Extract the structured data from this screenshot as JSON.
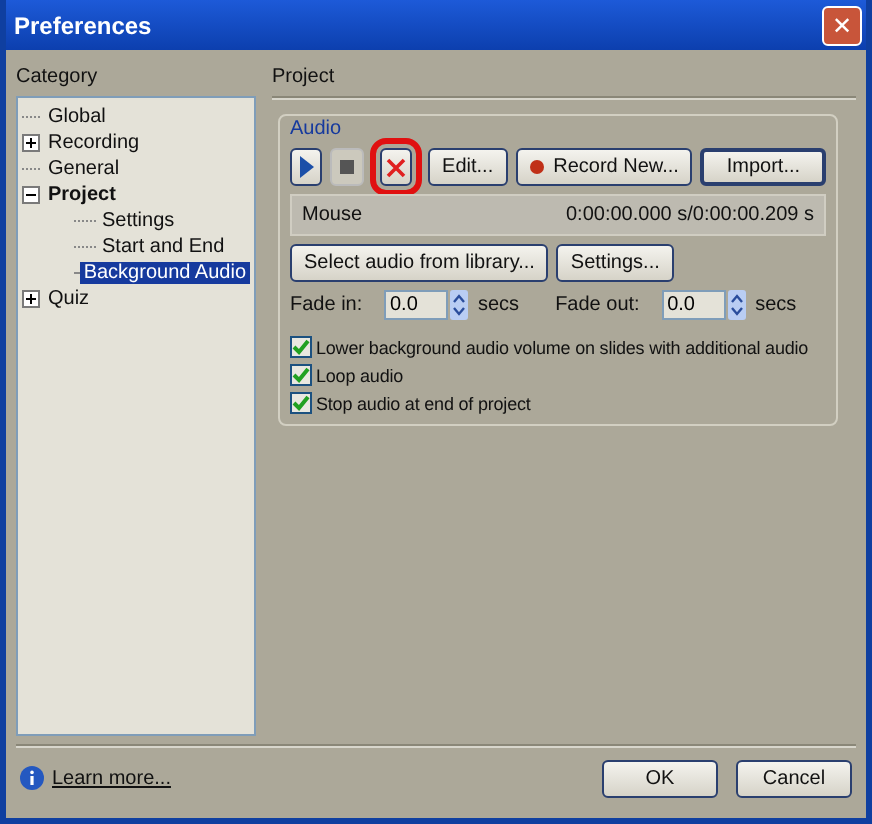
{
  "window": {
    "title": "Preferences",
    "close": "✕"
  },
  "category": {
    "label": "Category",
    "items": [
      {
        "label": "Global",
        "selected": false
      },
      {
        "label": "Recording",
        "expanded": false,
        "selected": false
      },
      {
        "label": "General",
        "selected": false
      },
      {
        "label": "Project",
        "expanded": true,
        "selected": false,
        "children": [
          {
            "label": "Settings",
            "selected": false
          },
          {
            "label": "Start and End",
            "selected": false
          },
          {
            "label": "Background Audio",
            "selected": true
          }
        ]
      },
      {
        "label": "Quiz",
        "expanded": false,
        "selected": false
      }
    ]
  },
  "panel": {
    "title": "Project",
    "group": "Audio",
    "toolbar": [
      {
        "kind": "play",
        "highlighted": false
      },
      {
        "kind": "stop",
        "highlighted": false
      },
      {
        "kind": "delete",
        "highlighted": true
      },
      {
        "kind": "text",
        "label": "Edit...",
        "highlighted": false
      },
      {
        "kind": "record",
        "label": "Record New...",
        "highlighted": false
      },
      {
        "kind": "text",
        "label": "Import...",
        "highlighted": false
      }
    ],
    "file": {
      "name": "Mouse",
      "time": "0:00:00.000 s/0:00:00.209 s"
    },
    "buttons": [
      "Select audio from library...",
      "Settings..."
    ],
    "fades": [
      {
        "label": "Fade in:",
        "value": "0.0",
        "unit": "secs"
      },
      {
        "label": "Fade out:",
        "value": "0.0",
        "unit": "secs"
      }
    ],
    "options": [
      {
        "label": "Lower background audio volume on slides with additional audio",
        "checked": true
      },
      {
        "label": "Loop audio",
        "checked": true
      },
      {
        "label": "Stop audio at end of project",
        "checked": true
      }
    ]
  },
  "footer": {
    "link": "Learn more...",
    "buttons": [
      "OK",
      "Cancel"
    ]
  }
}
